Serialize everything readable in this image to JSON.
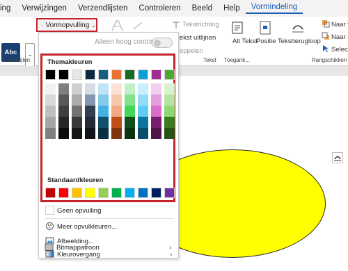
{
  "menubar": {
    "items": [
      "ing",
      "Verwijzingen",
      "Verzendlijsten",
      "Controleren",
      "Beeld",
      "Help",
      "Vormindeling"
    ],
    "active": "Vormindeling"
  },
  "ribbon": {
    "abc_label": "Abc",
    "shape_styles_label": "Vormstijlen",
    "fill_button_label": "Vormopvulling",
    "text_direction": "Tekstrichting",
    "text_align": "ekst uitlijnen",
    "link_text": "oppelen",
    "text_group_label": "Tekst",
    "alt_text_label": "Alt Tekst",
    "accessibility_group_label": "Toegank...",
    "position_label": "Positie",
    "wrap_text_label": "Tekstterugloop",
    "bring_forward_label": "Naar v",
    "send_backward_label": "Naar a",
    "selection_label": "Selecti",
    "arrange_group_label": "Rangschikken"
  },
  "dropdown": {
    "high_contrast_label": "Alleen hoog contrast",
    "theme_colors_heading": "Themakleuren",
    "standard_colors_heading": "Standaardkleuren",
    "theme_base_colors": [
      "#000000",
      "#000000",
      "#e7e6e6",
      "#0e2841",
      "#156082",
      "#e97132",
      "#196b24",
      "#0f9ed5",
      "#a02b93",
      "#4ea72e"
    ],
    "theme_shades": [
      [
        "#f2f2f2",
        "#7f7f7f",
        "#d0cece",
        "#d6dce4",
        "#c1e4f5",
        "#fbe2d5",
        "#c1f0c8",
        "#caeefb",
        "#f2cfee",
        "#d9f2d0"
      ],
      [
        "#d9d9d9",
        "#595959",
        "#aeaaaa",
        "#8497b0",
        "#83caeb",
        "#f7c7ac",
        "#83e28e",
        "#95dcf8",
        "#e59edd",
        "#b4e5a2"
      ],
      [
        "#bfbfbf",
        "#3f3f3f",
        "#757171",
        "#333f4f",
        "#45b0e1",
        "#f1a983",
        "#47d45a",
        "#60cbf3",
        "#d86dcb",
        "#8ed973"
      ],
      [
        "#a6a6a6",
        "#262626",
        "#3a3838",
        "#222a35",
        "#124f6d",
        "#c04f15",
        "#124f1a",
        "#0b76a0",
        "#77206d",
        "#3a7c22"
      ],
      [
        "#808080",
        "#0d0d0d",
        "#171616",
        "#11151b",
        "#0a2e42",
        "#803410",
        "#0a3410",
        "#084f6b",
        "#4f1548",
        "#275317"
      ]
    ],
    "standard_colors": [
      "#c00000",
      "#ff0000",
      "#ffc000",
      "#ffff00",
      "#92d050",
      "#00b050",
      "#00b0f0",
      "#0070c0",
      "#002060",
      "#7030a0"
    ],
    "no_fill_label": "Geen opvulling",
    "more_colors_label": "Meer opvulkleuren...",
    "picture_label": "Afbeelding...",
    "gradient_label": "Kleurovergang",
    "texture_label": "Bitmappatroon"
  },
  "document": {
    "shape_fill_color": "#ffff00",
    "shape_type": "ellipse"
  }
}
